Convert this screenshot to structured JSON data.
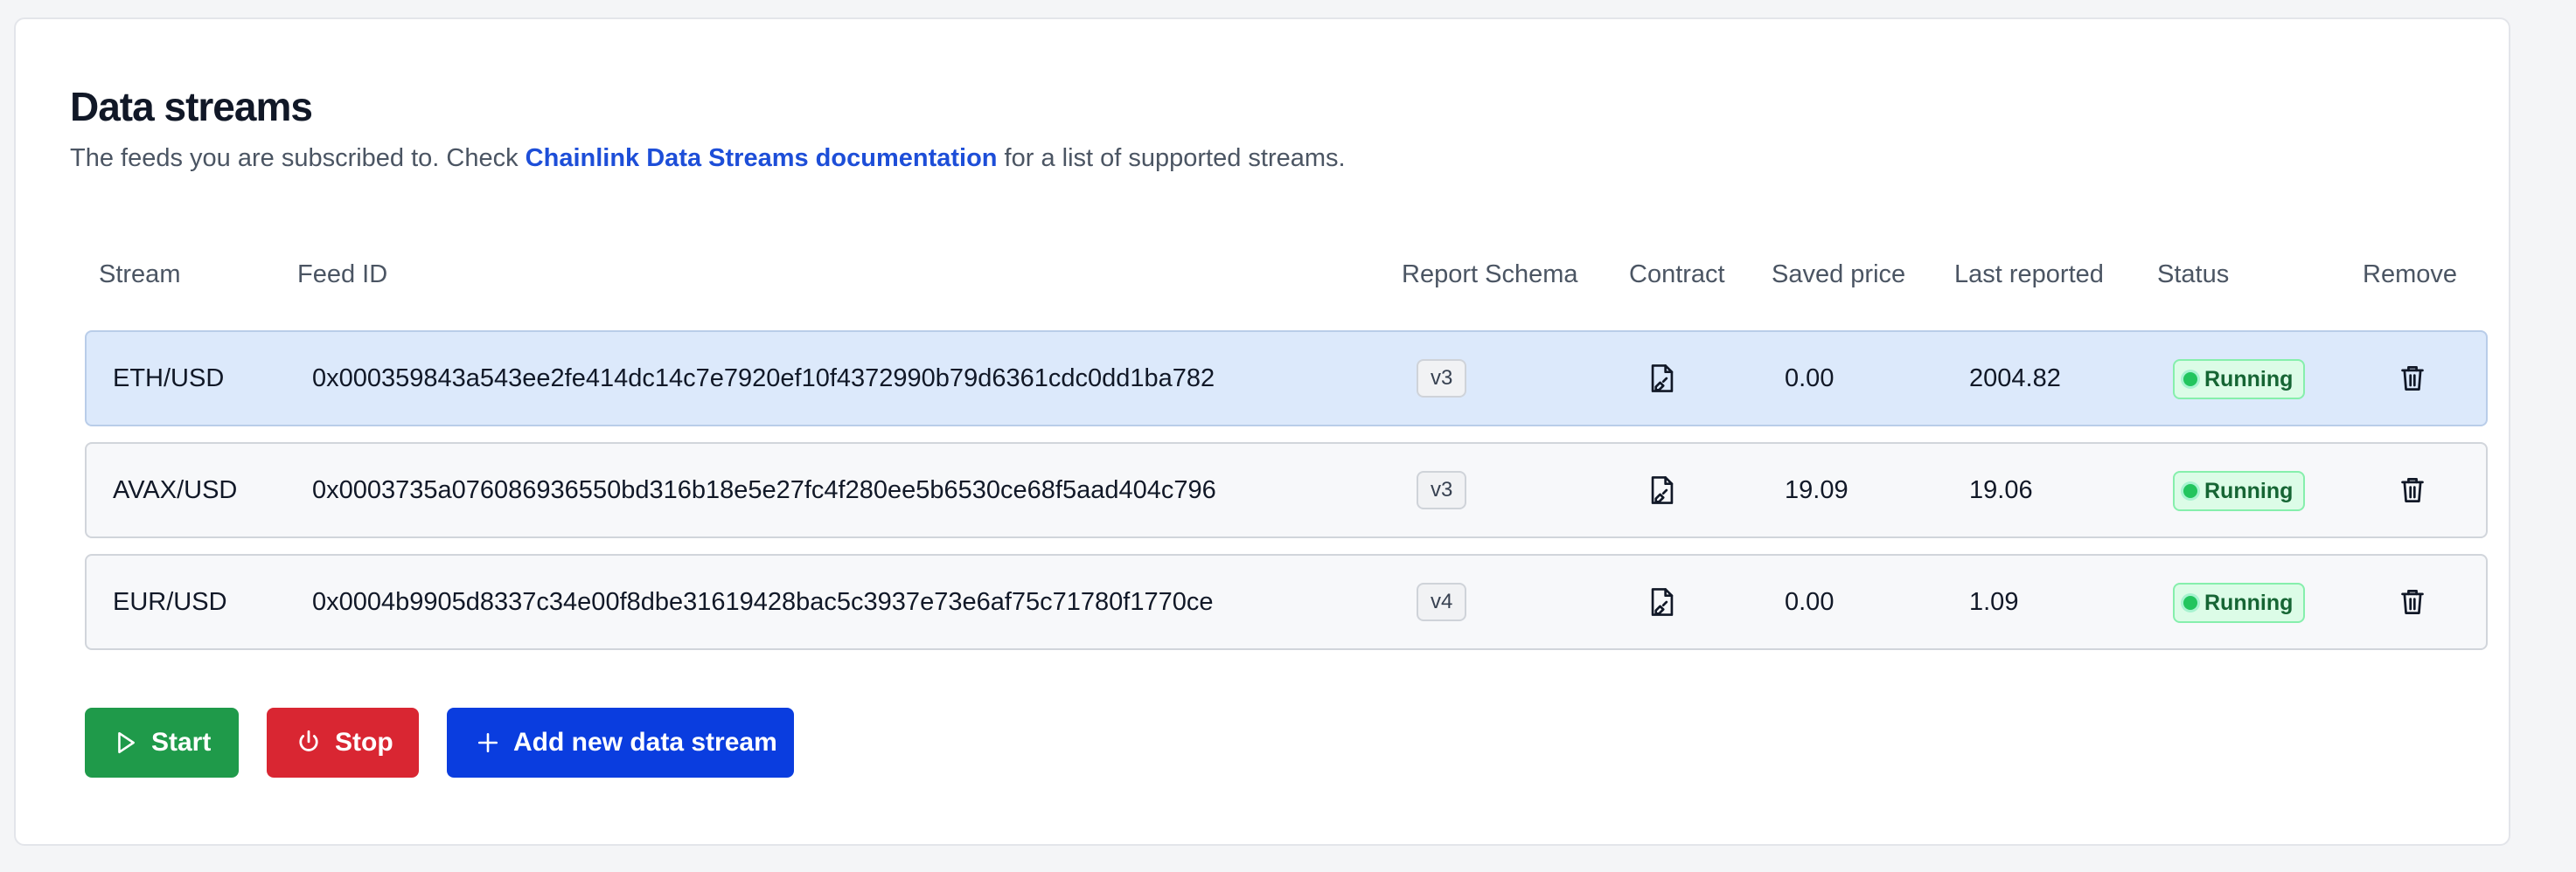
{
  "page": {
    "title": "Data streams",
    "subtitle_before": "The feeds you are subscribed to. Check ",
    "subtitle_link": "Chainlink Data Streams documentation",
    "subtitle_after": " for a list of supported streams."
  },
  "table": {
    "headers": {
      "stream": "Stream",
      "feed_id": "Feed ID",
      "report_schema": "Report Schema",
      "contract": "Contract",
      "saved_price": "Saved price",
      "last_reported": "Last reported",
      "status": "Status",
      "remove": "Remove"
    },
    "rows": [
      {
        "stream": "ETH/USD",
        "feed_id": "0x000359843a543ee2fe414dc14c7e7920ef10f4372990b79d6361cdc0dd1ba782",
        "schema": "v3",
        "saved_price": "0.00",
        "last_reported": "2004.82",
        "status": "Running",
        "selected": true
      },
      {
        "stream": "AVAX/USD",
        "feed_id": "0x0003735a076086936550bd316b18e5e27fc4f280ee5b6530ce68f5aad404c796",
        "schema": "v3",
        "saved_price": "19.09",
        "last_reported": "19.06",
        "status": "Running",
        "selected": false
      },
      {
        "stream": "EUR/USD",
        "feed_id": "0x0004b9905d8337c34e00f8dbe31619428bac5c3937e73e6af75c71780f1770ce",
        "schema": "v4",
        "saved_price": "0.00",
        "last_reported": "1.09",
        "status": "Running",
        "selected": false
      }
    ]
  },
  "actions": {
    "start_label": "Start",
    "stop_label": "Stop",
    "add_label": "Add new data stream"
  },
  "colors": {
    "start": "#1f9a4a",
    "stop": "#d92632",
    "add": "#0a3ddf",
    "link": "#1d4ed8",
    "selected_row": "#dce9fb",
    "running_badge": "#dcfce7"
  },
  "icons": {
    "contract": "file-signature-icon",
    "remove": "trash-icon",
    "start": "play-icon",
    "stop": "power-icon",
    "add": "plus-icon",
    "status": "status-dot-icon"
  }
}
